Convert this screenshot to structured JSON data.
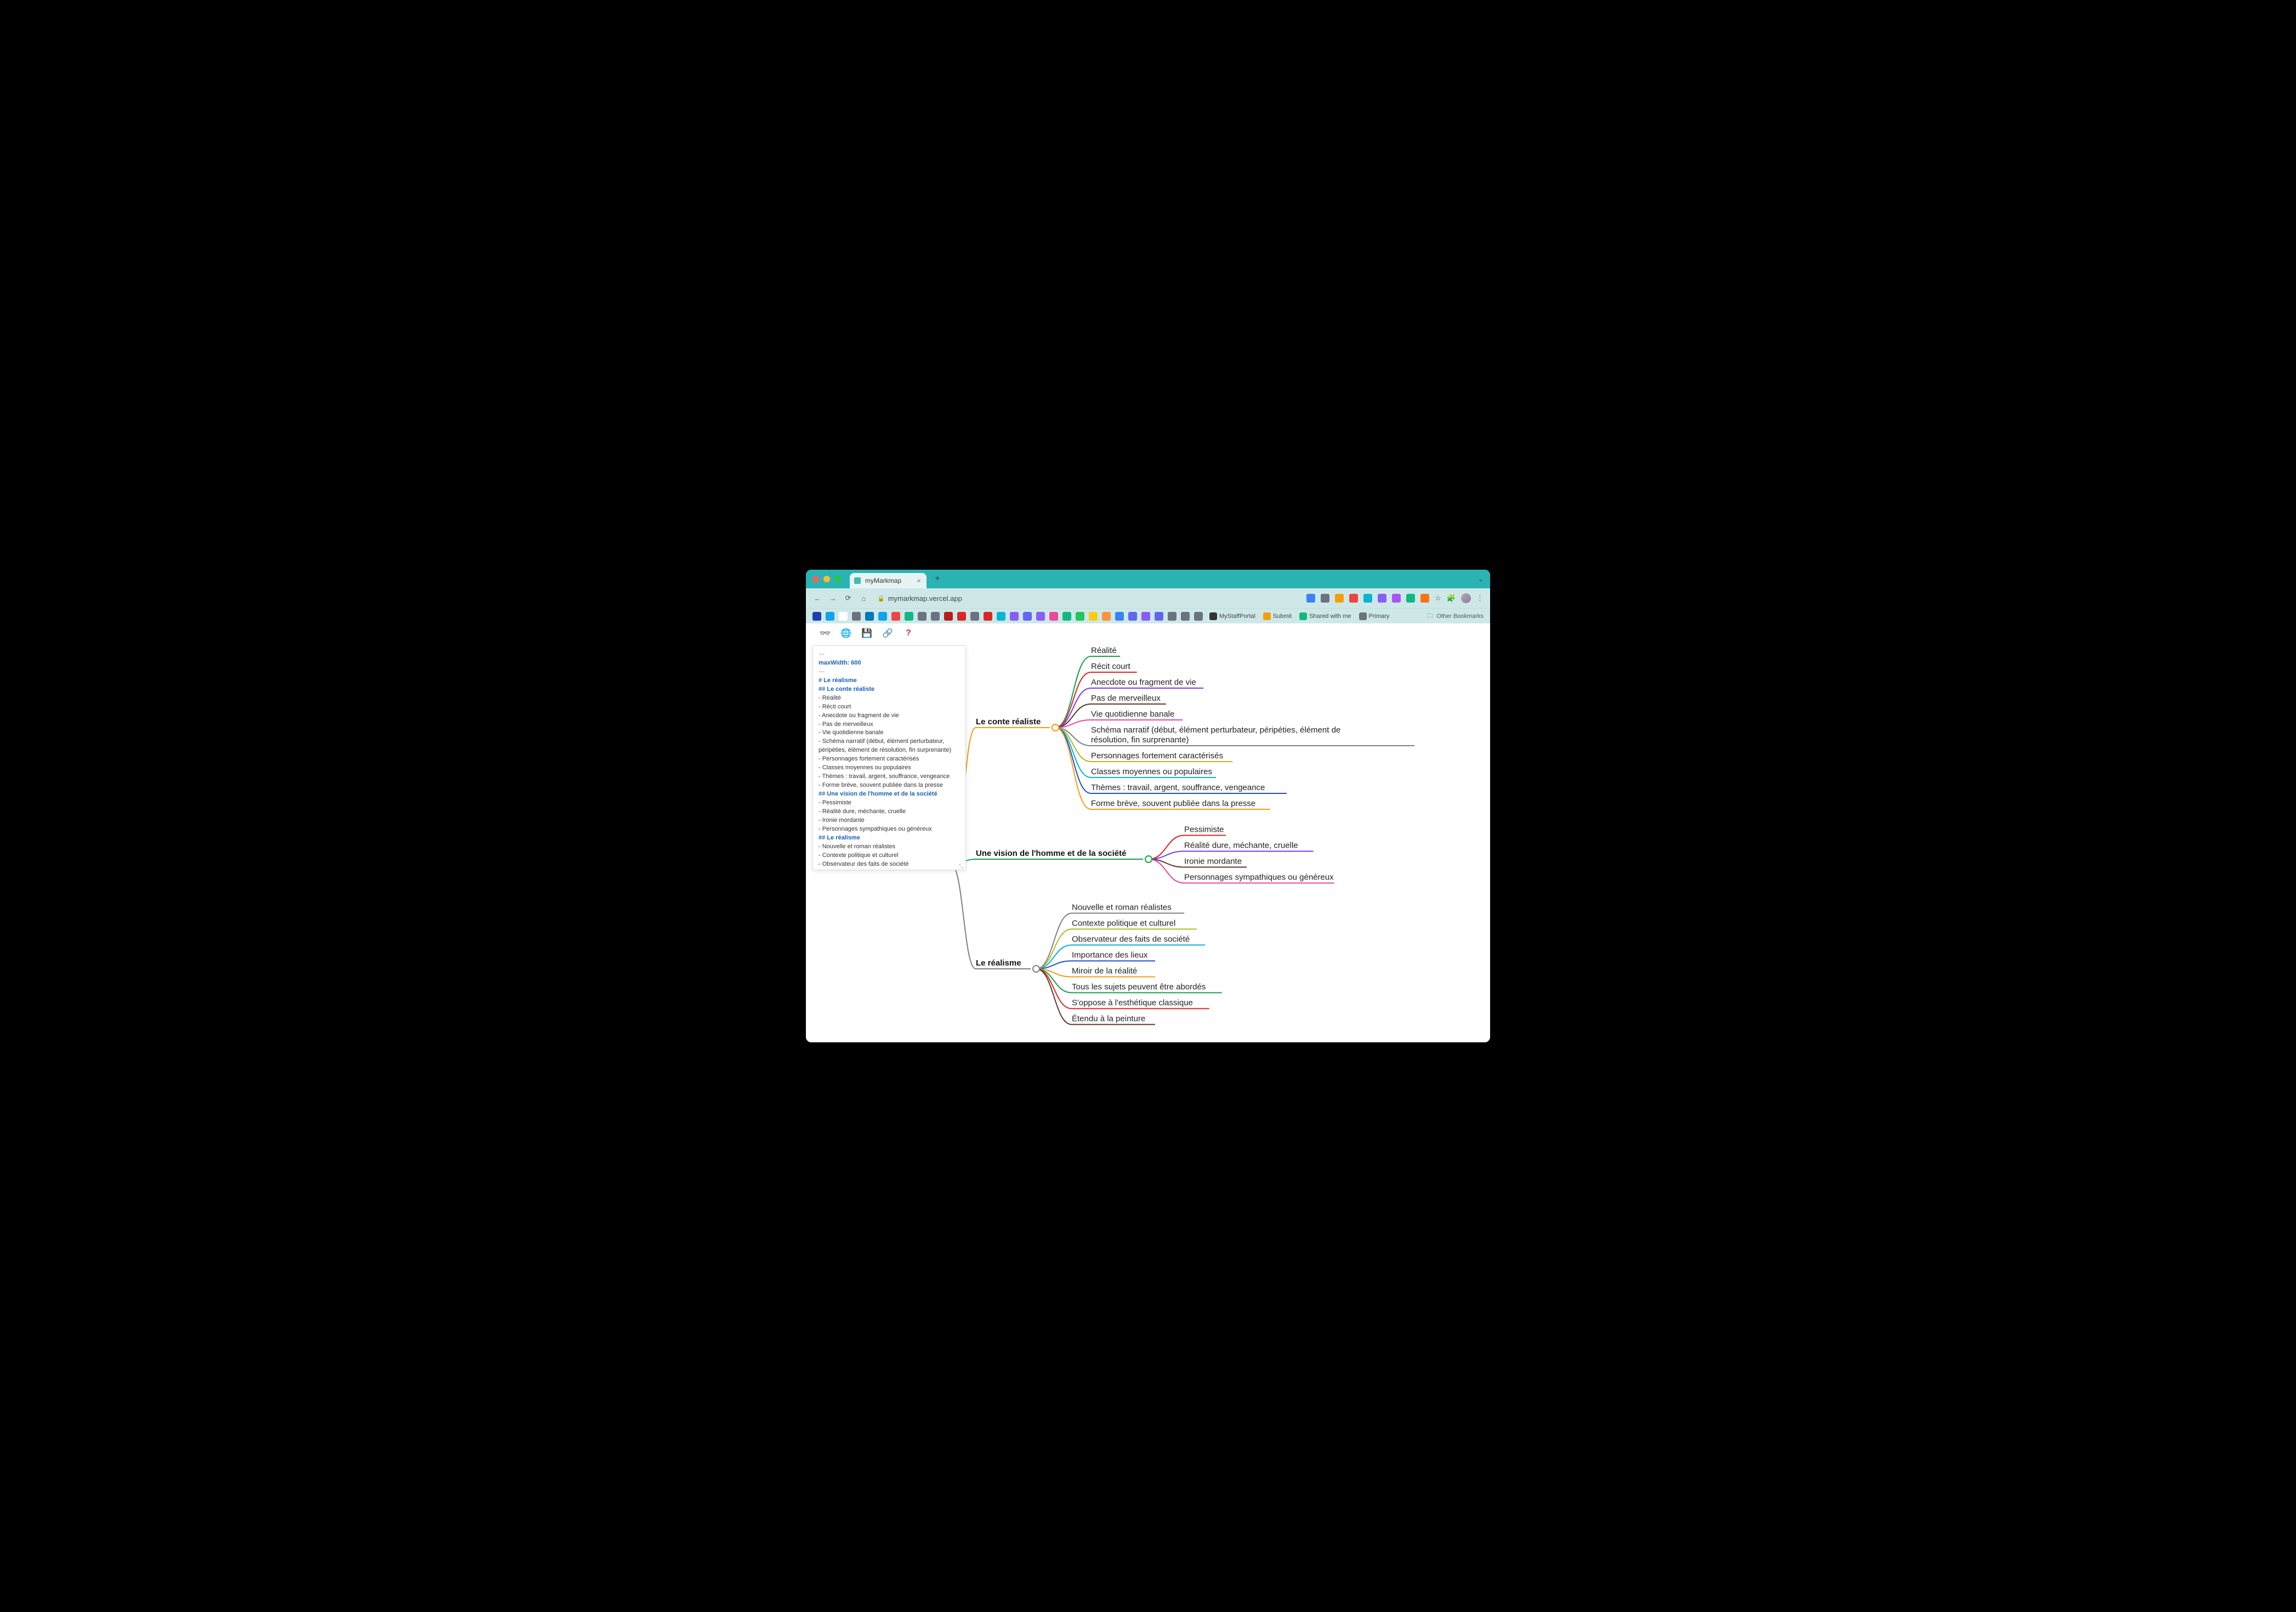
{
  "browser": {
    "tab_title": "myMarkmap",
    "new_tab_glyph": "+",
    "expand_glyph": "⌄",
    "nav": {
      "back": "←",
      "forward": "→",
      "reload": "⟳",
      "home": "⌂"
    },
    "url_host": "mymarkmap.vercel.app",
    "lock_glyph": "🔒",
    "ext_colors": [
      "#3b82f6",
      "#6b7280",
      "#f59e0b",
      "#ef4444",
      "#06b6d4",
      "#8b5cf6",
      "#a855f7",
      "#10b981",
      "#f97316"
    ],
    "avatar": true,
    "menu_glyph": "⋮",
    "bookmarks_left_colors": [
      "#1e40af",
      "#0ea5e9",
      "#ffffff",
      "#6b7280",
      "#0077b5",
      "#0ea5e9",
      "#ef4444",
      "#10b981",
      "#6b7280",
      "#6b7280",
      "#b91c1c",
      "#dc2626",
      "#6b7280",
      "#dc2626",
      "#06b6d4",
      "#8b5cf6",
      "#6366f1",
      "#8b5cf6",
      "#ec4899",
      "#10b981",
      "#22c55e",
      "#facc15",
      "#fb923c",
      "#3b82f6",
      "#6366f1",
      "#8b5cf6",
      "#6366f1",
      "#6b7280",
      "#6b7280",
      "#6b7280"
    ],
    "bookmark_links": [
      {
        "icon_color": "#333",
        "label": "MyStaffPortal"
      },
      {
        "icon_color": "#f59e0b",
        "label": "Submit"
      },
      {
        "icon_color": "#10b981",
        "label": "Shared with me"
      },
      {
        "icon_color": "#6b7280",
        "label": "Primary"
      }
    ],
    "other_bookmarks_label": "Other Bookmarks",
    "folder_glyph": "🗀"
  },
  "toolbar": {
    "glasses_glyph": "👓",
    "globe_glyph": "🌐",
    "save_glyph": "💾",
    "link_glyph": "🔗",
    "help_glyph": "?"
  },
  "editor": {
    "lines": [
      {
        "cls": "ed-gray",
        "text": "---"
      },
      {
        "cls": "ed-blue",
        "text": "maxWidth: 600"
      },
      {
        "cls": "ed-gray",
        "text": "---"
      },
      {
        "cls": "",
        "text": " "
      },
      {
        "cls": "ed-h1",
        "text": "# Le réalisme"
      },
      {
        "cls": "",
        "text": " "
      },
      {
        "cls": "ed-h2",
        "text": "## Le conte réaliste"
      },
      {
        "cls": "",
        "text": " "
      },
      {
        "cls": "",
        "text": "- Réalité"
      },
      {
        "cls": "",
        "text": "- Récit court"
      },
      {
        "cls": "",
        "text": "- Anecdote ou fragment de vie"
      },
      {
        "cls": "",
        "text": "- Pas de merveilleux"
      },
      {
        "cls": "",
        "text": "- Vie quotidienne banale"
      },
      {
        "cls": "",
        "text": "- Schéma narratif (début, élément perturbateur, péripéties, élément de résolution, fin surprenante)"
      },
      {
        "cls": "",
        "text": "- Personnages fortement caractérisés"
      },
      {
        "cls": "",
        "text": "- Classes moyennes ou populaires"
      },
      {
        "cls": "",
        "text": "- Thèmes : travail, argent, souffrance, vengeance"
      },
      {
        "cls": "",
        "text": "- Forme brève, souvent publiée dans la presse"
      },
      {
        "cls": "",
        "text": " "
      },
      {
        "cls": "ed-h2",
        "text": "## Une vision de l'homme et de la société"
      },
      {
        "cls": "",
        "text": " "
      },
      {
        "cls": "",
        "text": "- Pessimiste"
      },
      {
        "cls": "",
        "text": "- Réalité dure, méchante, cruelle"
      },
      {
        "cls": "",
        "text": "- Ironie mordante"
      },
      {
        "cls": "",
        "text": "- Personnages sympathiques ou généreux"
      },
      {
        "cls": "",
        "text": " "
      },
      {
        "cls": "ed-h2",
        "text": "## Le réalisme"
      },
      {
        "cls": "",
        "text": " "
      },
      {
        "cls": "",
        "text": "- Nouvelle et roman réalistes"
      },
      {
        "cls": "",
        "text": "- Contexte politique et culturel"
      },
      {
        "cls": "",
        "text": "- Observateur des faits de société"
      }
    ],
    "resize_glyph": "⤡"
  },
  "chart_data": {
    "type": "mindmap",
    "root_color": "#808080",
    "root": {
      "label": "",
      "children": [
        {
          "label": "Le conte réaliste",
          "color": "#f59e0b",
          "children": [
            {
              "label": "Réalité",
              "color": "#16a34a"
            },
            {
              "label": "Récit court",
              "color": "#dc2626"
            },
            {
              "label": "Anecdote ou fragment de vie",
              "color": "#7c3aed"
            },
            {
              "label": "Pas de merveilleux",
              "color": "#5b3a29"
            },
            {
              "label": "Vie quotidienne banale",
              "color": "#ec4899"
            },
            {
              "label": "Schéma narratif (début, élément perturbateur, péripéties, élément de résolution, fin surprenante)",
              "color": "#808080",
              "wrap": true
            },
            {
              "label": "Personnages fortement caractérisés",
              "color": "#b0bc1f"
            },
            {
              "label": "Classes moyennes ou populaires",
              "color": "#06b6d4"
            },
            {
              "label": "Thèmes : travail, argent, souffrance, vengeance",
              "color": "#1d4ed8"
            },
            {
              "label": "Forme brève, souvent publiée dans la presse",
              "color": "#f59e0b"
            }
          ]
        },
        {
          "label": "Une vision de l'homme et de la société",
          "color": "#16a34a",
          "children": [
            {
              "label": "Pessimiste",
              "color": "#dc2626"
            },
            {
              "label": "Réalité dure, méchante, cruelle",
              "color": "#7c3aed"
            },
            {
              "label": "Ironie mordante",
              "color": "#5b3a29"
            },
            {
              "label": "Personnages sympathiques ou généreux",
              "color": "#ec4899"
            }
          ]
        },
        {
          "label": "Le réalisme",
          "color": "#808080",
          "children": [
            {
              "label": "Nouvelle et roman réalistes",
              "color": "#808080"
            },
            {
              "label": "Contexte politique et culturel",
              "color": "#b0bc1f"
            },
            {
              "label": "Observateur des faits de société",
              "color": "#06b6d4"
            },
            {
              "label": "Importance des lieux",
              "color": "#1d4ed8"
            },
            {
              "label": "Miroir de la réalité",
              "color": "#f59e0b"
            },
            {
              "label": "Tous les sujets peuvent être abordés",
              "color": "#16a34a"
            },
            {
              "label": "S'oppose à l'esthétique classique",
              "color": "#dc2626"
            },
            {
              "label": "Étendu à la peinture",
              "color": "#5b3a29"
            }
          ]
        }
      ]
    }
  }
}
